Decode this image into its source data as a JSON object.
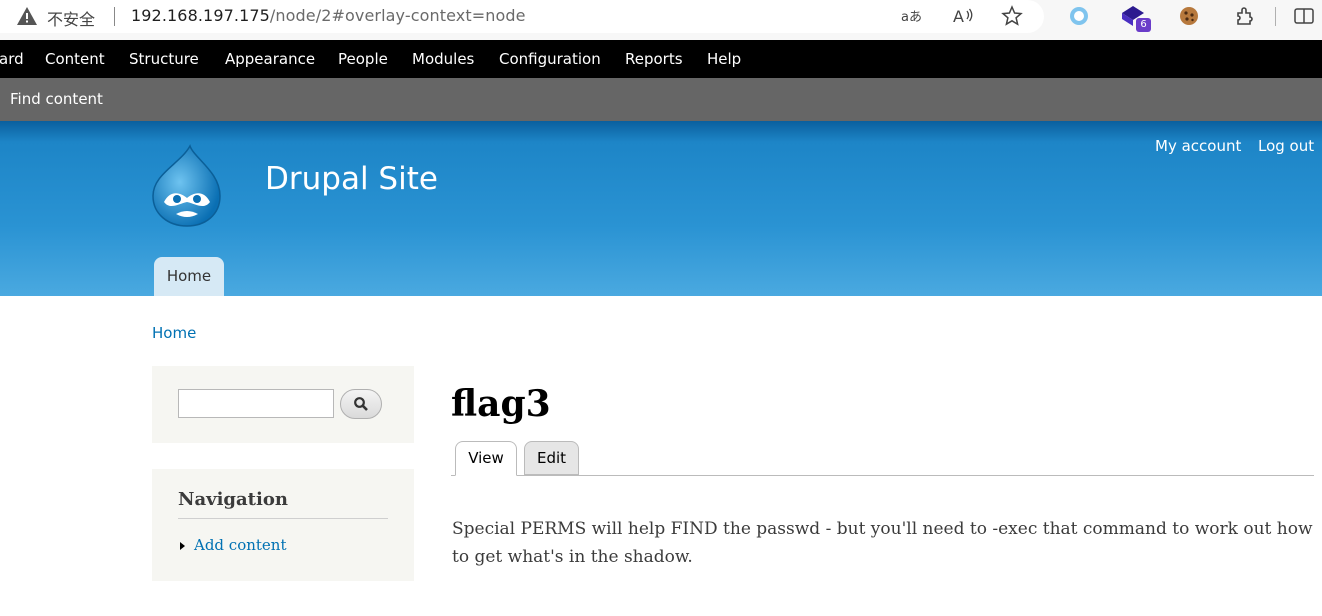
{
  "browser": {
    "insecure_label": "不安全",
    "url_host": "192.168.197.175",
    "url_path": "/node/2#overlay-context=node",
    "extension_badge": "6"
  },
  "admin_toolbar": {
    "items": [
      "ard",
      "Content",
      "Structure",
      "Appearance",
      "People",
      "Modules",
      "Configuration",
      "Reports",
      "Help"
    ]
  },
  "shortcut_bar": {
    "find_content": "Find content"
  },
  "header": {
    "site_name": "Drupal Site",
    "secondary_menu": [
      "My account",
      "Log out"
    ],
    "main_menu": [
      "Home"
    ]
  },
  "breadcrumb": "Home",
  "search": {
    "input_value": ""
  },
  "navigation": {
    "title": "Navigation",
    "items": [
      "Add content"
    ]
  },
  "node": {
    "title": "flag3",
    "tabs": [
      "View",
      "Edit"
    ],
    "body": "Special PERMS will help FIND the passwd - but you'll need to -exec that command to work out how to get what's in the shadow."
  },
  "colors": {
    "admin_bar": "#000000",
    "shortcut_bar": "#666666",
    "header_blue": "#2a93d3",
    "link": "#0071b3"
  }
}
